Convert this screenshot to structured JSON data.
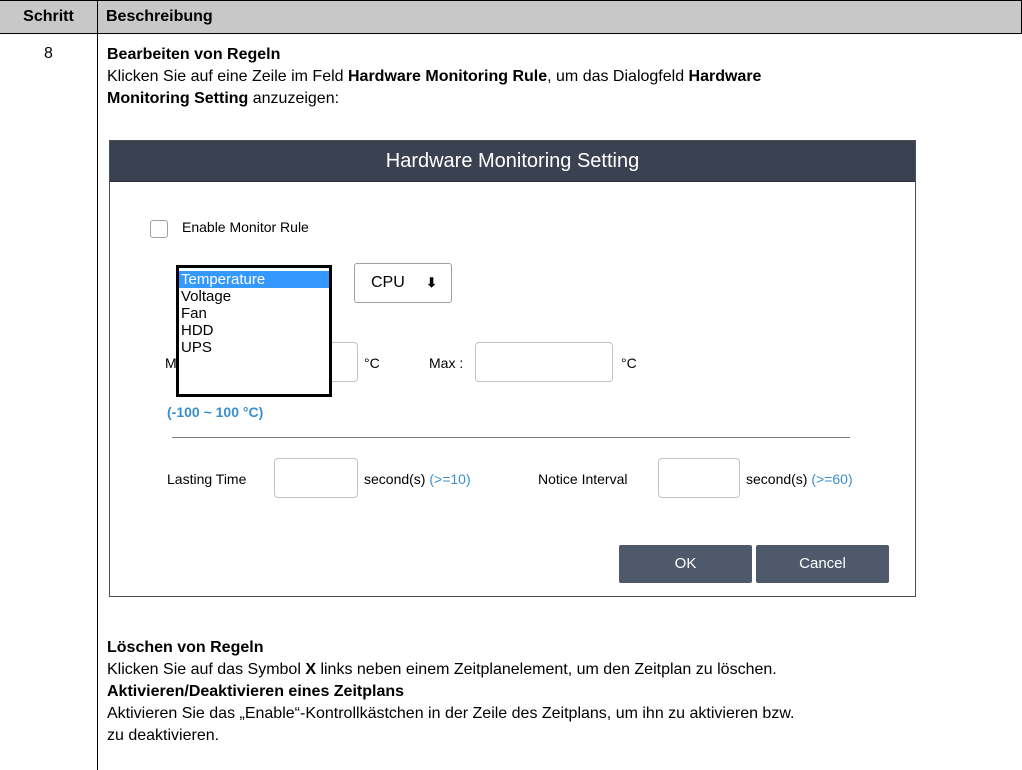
{
  "table": {
    "header_step": "Schritt",
    "header_desc": "Beschreibung",
    "step_number": "8"
  },
  "section_edit": {
    "heading": "Bearbeiten von Regeln",
    "text_1": "Klicken Sie auf eine Zeile im Feld ",
    "bold_1": "Hardware Monitoring Rule",
    "text_2": ", um das Dialogfeld ",
    "bold_2": "Hardware",
    "bold_3": "Monitoring Setting",
    "text_3": " anzuzeigen:"
  },
  "dialog": {
    "title": "Hardware Monitoring Setting",
    "enable_label": "Enable Monitor Rule",
    "type_options": [
      "Temperature",
      "Voltage",
      "Fan",
      "HDD",
      "UPS"
    ],
    "selected_type": "Temperature",
    "device_select": "CPU",
    "min_label_partial": "M",
    "unit": "°C",
    "max_label": "Max :",
    "range_hint": "(-100 ~ 100 °C)",
    "lasting_label": "Lasting Time",
    "lasting_unit": "second(s)",
    "lasting_hint": "(>=10)",
    "notice_label": "Notice Interval",
    "notice_unit": "second(s)",
    "notice_hint": "(>=60)",
    "ok_label": "OK",
    "cancel_label": "Cancel",
    "colors": {
      "titlebar": "#3a4150",
      "button": "#4e5a6c",
      "hint": "#3a8fd1",
      "selection": "#3399ff"
    }
  },
  "section_delete": {
    "heading": "Löschen von Regeln",
    "text_1": "Klicken Sie auf das Symbol ",
    "bold_1": "X",
    "text_2": " links neben einem Zeitplanelement, um den Zeitplan zu löschen."
  },
  "section_toggle": {
    "heading": "Aktivieren/Deaktivieren eines Zeitplans",
    "text_line_1": "Aktivieren Sie das „Enable“-Kontrollkästchen in der Zeile des Zeitplans, um ihn zu aktivieren bzw.",
    "text_line_2": "zu deaktivieren."
  }
}
